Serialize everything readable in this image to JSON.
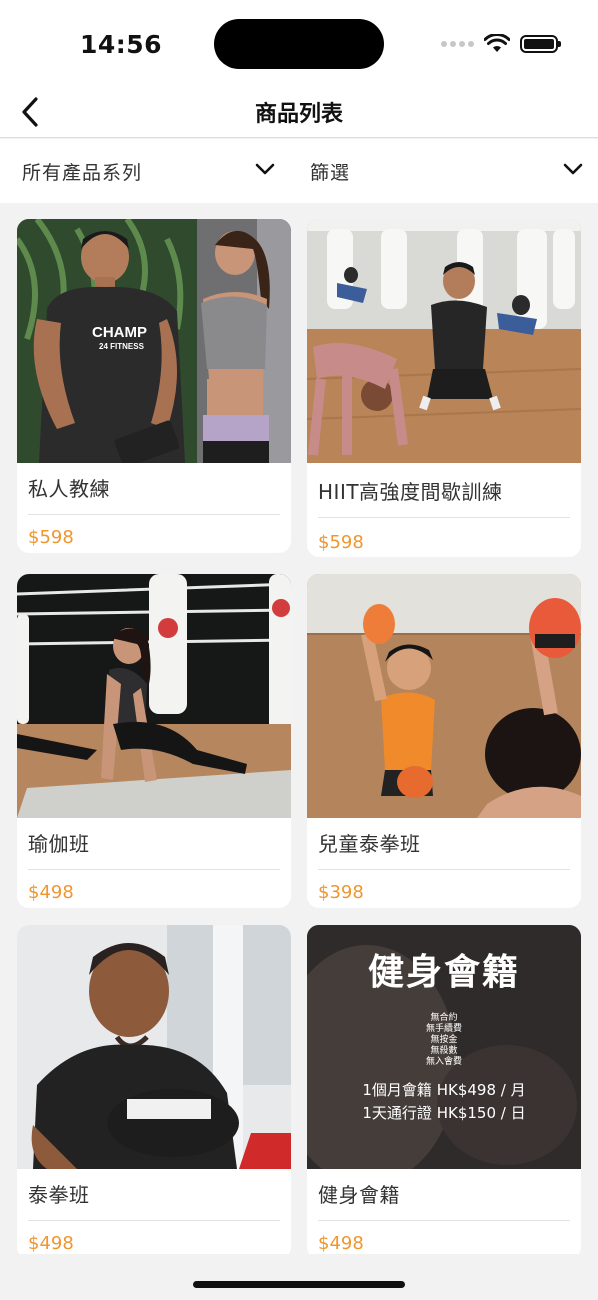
{
  "status_bar": {
    "time": "14:56"
  },
  "nav": {
    "title": "商品列表"
  },
  "filters": {
    "series_label": "所有產品系列",
    "screen_label": "篩選"
  },
  "products": [
    {
      "name": "私人教練",
      "price": "$598"
    },
    {
      "name": "HIIT高強度間歇訓練",
      "price": "$598"
    },
    {
      "name": "瑜伽班",
      "price": "$498"
    },
    {
      "name": "兒童泰拳班",
      "price": "$398"
    },
    {
      "name": "泰拳班",
      "price": "$498"
    },
    {
      "name": "健身會籍",
      "price": "$498"
    }
  ],
  "images": {
    "trainer_shirt": "CHAMP",
    "trainer_shirt_sub": "24 FITNESS",
    "membership_banner": {
      "title": "健身會籍",
      "features": [
        "無合約",
        "無手續費",
        "無按金",
        "無殺數",
        "無入會費"
      ],
      "line1": "1個月會籍 HK$498 / 月",
      "line2": "1天通行證 HK$150 / 日"
    }
  },
  "colors": {
    "price": "#f0962e",
    "background": "#f2f2f2"
  }
}
